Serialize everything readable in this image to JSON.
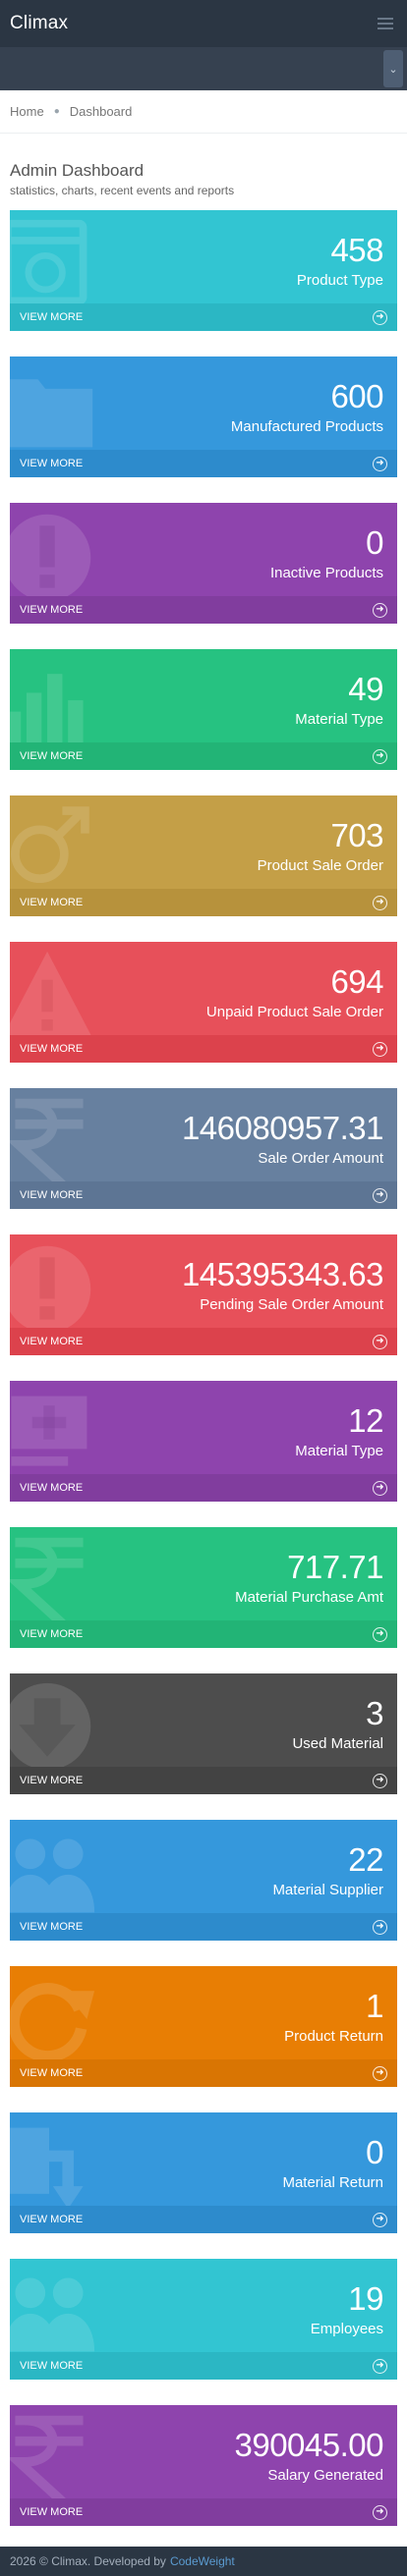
{
  "app": {
    "brand": "Climax"
  },
  "breadcrumb": {
    "home": "Home",
    "current": "Dashboard"
  },
  "page": {
    "title": "Admin Dashboard",
    "subtitle": "statistics, charts, recent events and reports"
  },
  "tile_more_label": "VIEW MORE",
  "tiles": [
    {
      "value": "458",
      "label": "Product Type",
      "color": "#32c5d2",
      "more_color": "#2bb7c4",
      "icon": "browser-icon"
    },
    {
      "value": "600",
      "label": "Manufactured Products",
      "color": "#3598dc",
      "more_color": "#2d8bcc",
      "icon": "folder-icon"
    },
    {
      "value": "0",
      "label": "Inactive Products",
      "color": "#8e44ad",
      "more_color": "#813d9e",
      "icon": "exclamation-icon"
    },
    {
      "value": "49",
      "label": "Material Type",
      "color": "#26c281",
      "more_color": "#22b476",
      "icon": "bar-chart-icon"
    },
    {
      "value": "703",
      "label": "Product Sale Order",
      "color": "#c49f47",
      "more_color": "#b7923c",
      "icon": "gender-icon"
    },
    {
      "value": "694",
      "label": "Unpaid Product Sale Order",
      "color": "#e7505a",
      "more_color": "#dc424c",
      "icon": "warning-icon"
    },
    {
      "value": "146080957.31",
      "label": "Sale Order Amount",
      "color": "#67809f",
      "more_color": "#5d7594",
      "icon": "rupee-icon"
    },
    {
      "value": "145395343.63",
      "label": "Pending Sale Order Amount",
      "color": "#e7505a",
      "more_color": "#dc424c",
      "icon": "exclamation-icon"
    },
    {
      "value": "12",
      "label": "Material Type",
      "color": "#8e44ad",
      "more_color": "#813d9e",
      "icon": "add-list-icon"
    },
    {
      "value": "717.71",
      "label": "Material Purchase Amt",
      "color": "#26c281",
      "more_color": "#22b476",
      "icon": "rupee-icon"
    },
    {
      "value": "3",
      "label": "Used Material",
      "color": "#4d4d4d",
      "more_color": "#434343",
      "icon": "arrow-down-circle-icon"
    },
    {
      "value": "22",
      "label": "Material Supplier",
      "color": "#3598dc",
      "more_color": "#2d8bcc",
      "icon": "users-icon"
    },
    {
      "value": "1",
      "label": "Product Return",
      "color": "#e87e04",
      "more_color": "#d97503",
      "icon": "refresh-icon"
    },
    {
      "value": "0",
      "label": "Material Return",
      "color": "#3598dc",
      "more_color": "#2d8bcc",
      "icon": "return-arrow-icon"
    },
    {
      "value": "19",
      "label": "Employees",
      "color": "#32c5d2",
      "more_color": "#2bb7c4",
      "icon": "users-icon"
    },
    {
      "value": "390045.00",
      "label": "Salary Generated",
      "color": "#8e44ad",
      "more_color": "#813d9e",
      "icon": "rupee-icon"
    }
  ],
  "footer": {
    "text": "2026 © Climax. Developed by",
    "developer": "CodeWeight"
  }
}
